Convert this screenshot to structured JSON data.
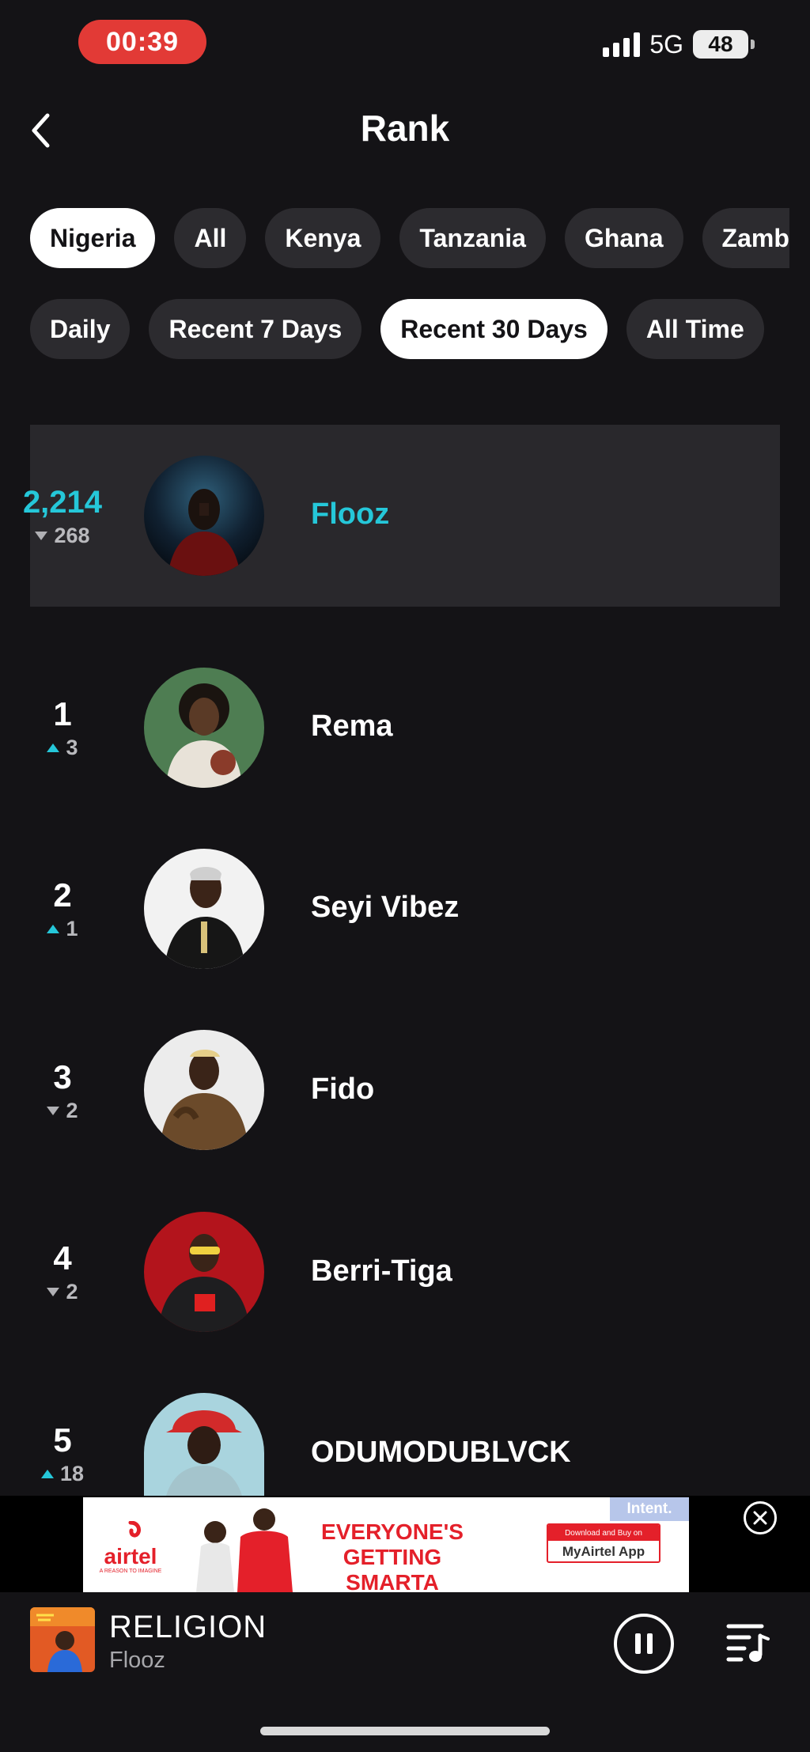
{
  "status": {
    "time": "00:39",
    "network": "5G",
    "battery": "48"
  },
  "header": {
    "title": "Rank"
  },
  "regions": [
    "Nigeria",
    "All",
    "Kenya",
    "Tanzania",
    "Ghana",
    "Zamb"
  ],
  "periods": [
    "Daily",
    "Recent 7 Days",
    "Recent 30 Days",
    "All Time"
  ],
  "selected_region": "Nigeria",
  "selected_period": "Recent 30 Days",
  "highlight": {
    "rank": "2,214",
    "change": "268",
    "direction": "down",
    "name": "Flooz"
  },
  "ranks": [
    {
      "rank": "1",
      "change": "3",
      "direction": "up",
      "name": "Rema"
    },
    {
      "rank": "2",
      "change": "1",
      "direction": "up",
      "name": "Seyi Vibez"
    },
    {
      "rank": "3",
      "change": "2",
      "direction": "down",
      "name": "Fido"
    },
    {
      "rank": "4",
      "change": "2",
      "direction": "down",
      "name": "Berri-Tiga"
    },
    {
      "rank": "5",
      "change": "18",
      "direction": "up",
      "name": "ODUMODUBLVCK"
    }
  ],
  "ad": {
    "brand": "airtel",
    "tagline": "A REASON TO IMAGINE",
    "headline_1": "EVERYONE'S",
    "headline_2": "GETTING SMARTA",
    "cta_small": "Download and Buy on",
    "cta_app": "MyAirtel App",
    "corner_tag": "Intent."
  },
  "player": {
    "title": "RELIGION",
    "artist": "Flooz"
  },
  "colors": {
    "accent": "#25c7d9",
    "background": "#141316",
    "chip": "#2c2b2f",
    "ad_red": "#e4202a"
  }
}
